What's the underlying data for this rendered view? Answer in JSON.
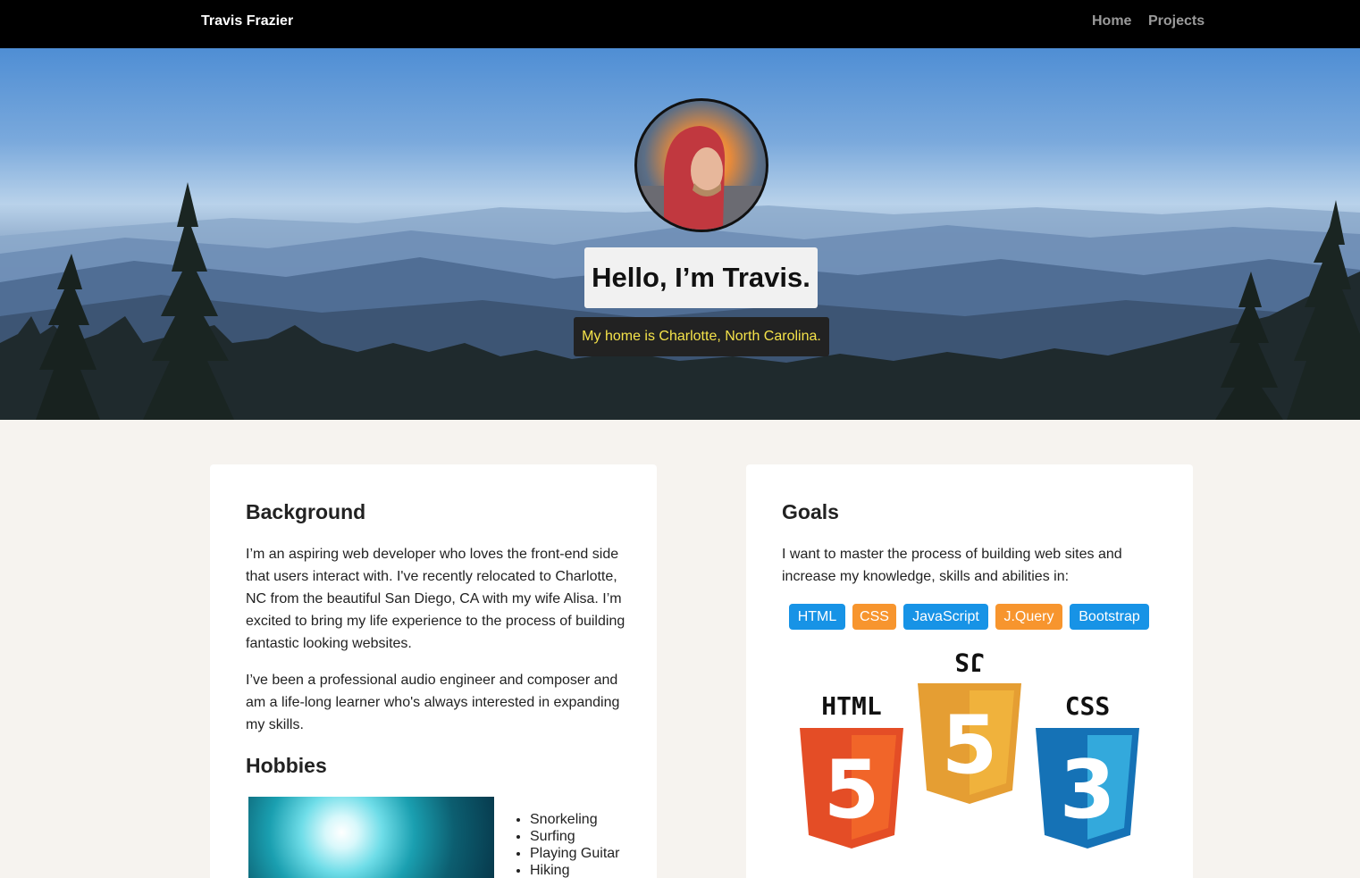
{
  "navbar": {
    "brand": "Travis Frazier",
    "links": [
      {
        "label": "Home"
      },
      {
        "label": "Projects"
      }
    ]
  },
  "hero": {
    "title": "Hello, I’m Travis.",
    "subtitle": "My home is Charlotte, North Carolina."
  },
  "background": {
    "title": "Background",
    "paragraph1": "I’m an aspiring web developer who loves the front-end side that users interact with. I've recently relocated to Charlotte, NC from the beautiful San Diego, CA with my wife Alisa. I’m excited to bring my life experience to the process of building fantastic looking websites.",
    "paragraph2": "I’ve been a professional audio engineer and composer and am a life-long learner who's always interested in expanding my skills."
  },
  "hobbies": {
    "title": "Hobbies",
    "items": [
      "Snorkeling",
      "Surfing",
      "Playing Guitar",
      "Hiking"
    ]
  },
  "goals": {
    "title": "Goals",
    "text": "I want to master the process of building web sites and increase my knowledge, skills and abilities in:",
    "skills": [
      {
        "label": "HTML",
        "color": "#1793e6"
      },
      {
        "label": "CSS",
        "color": "#f7952e"
      },
      {
        "label": "JavaScript",
        "color": "#1793e6"
      },
      {
        "label": "J.Query",
        "color": "#f7952e"
      },
      {
        "label": "Bootstrap",
        "color": "#1793e6"
      }
    ],
    "logos": {
      "html": "HTML",
      "js": "JS",
      "css": "CSS",
      "html_num": "5",
      "js_num": "5",
      "css_num": "3"
    }
  },
  "colors": {
    "navbar": "#000000",
    "page_bg": "#f6f3ef",
    "subtitle_text": "#f5e34a",
    "html5_orange": "#e44d26",
    "js_yellow": "#f0a534",
    "css3_blue": "#1572b6"
  }
}
